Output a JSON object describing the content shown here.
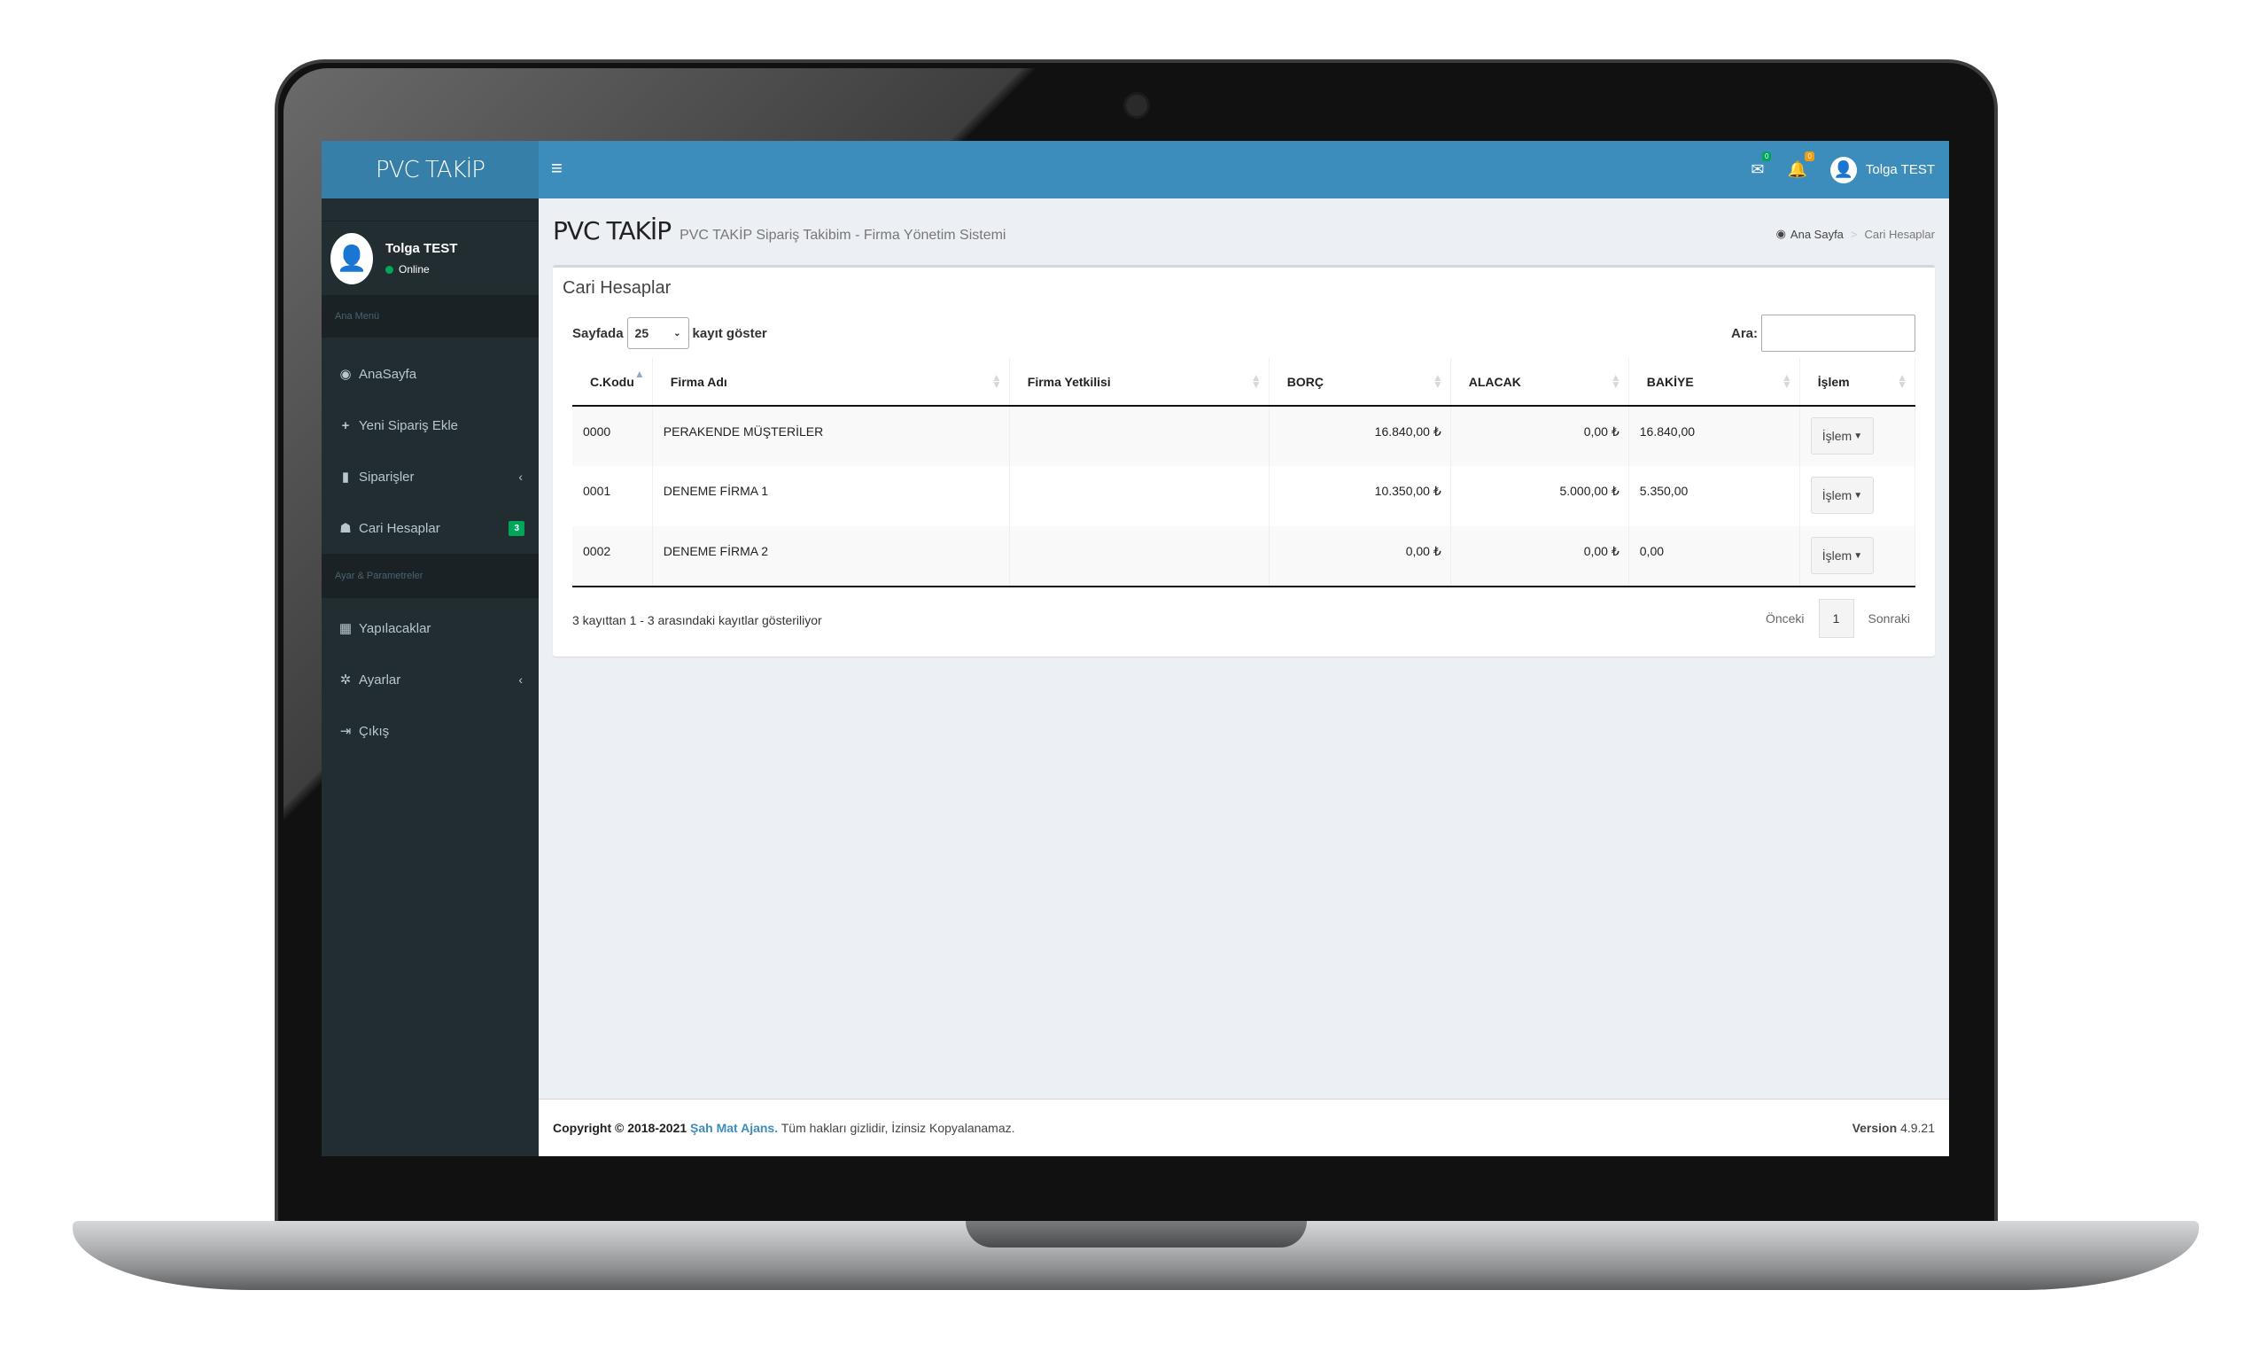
{
  "app": {
    "logo": "PVC TAKİP"
  },
  "user": {
    "name": "Tolga TEST",
    "status": "Online"
  },
  "sidebar": {
    "section_main": "Ana Menü",
    "items": [
      {
        "icon": "dashboard-icon",
        "label": "AnaSayfa"
      },
      {
        "icon": "plus-icon",
        "label": "Yeni Sipariş Ekle"
      },
      {
        "icon": "shopping-bag-icon",
        "label": "Siparişler",
        "chevron": "‹"
      },
      {
        "icon": "users-icon",
        "label": "Cari Hesaplar",
        "badge": "3"
      }
    ],
    "section_settings": "Ayar & Parametreler",
    "items2": [
      {
        "icon": "calendar-icon",
        "label": "Yapılacaklar"
      },
      {
        "icon": "gear-icon",
        "label": "Ayarlar",
        "chevron": "‹"
      },
      {
        "icon": "sign-out-icon",
        "label": "Çıkış"
      }
    ]
  },
  "topbar": {
    "hamburger": "≡",
    "mail_badge": "0",
    "bell_badge": "0",
    "user_name": "Tolga TEST"
  },
  "header": {
    "title": "PVC TAKİP",
    "subtitle": "PVC TAKİP Sipariş Takibim - Firma Yönetim Sistemi",
    "breadcrumb_home": "Ana Sayfa",
    "breadcrumb_sep": ">",
    "breadcrumb_current": "Cari Hesaplar"
  },
  "box": {
    "title": "Cari Hesaplar",
    "length_prefix": "Sayfada",
    "length_value": "25",
    "length_suffix": "kayıt göster",
    "search_label": "Ara:"
  },
  "table": {
    "columns": [
      "C.Kodu",
      "Firma Adı",
      "Firma Yetkilisi",
      "BORÇ",
      "ALACAK",
      "BAKİYE",
      "İşlem"
    ],
    "rows": [
      {
        "code": "0000",
        "name": "PERAKENDE MÜŞTERİLER",
        "contact": "",
        "debt": "16.840,00 ₺",
        "credit": "0,00 ₺",
        "balance": "16.840,00",
        "action": "İşlem"
      },
      {
        "code": "0001",
        "name": "DENEME FİRMA 1",
        "contact": "",
        "debt": "10.350,00 ₺",
        "credit": "5.000,00 ₺",
        "balance": "5.350,00",
        "action": "İşlem"
      },
      {
        "code": "0002",
        "name": "DENEME FİRMA 2",
        "contact": "",
        "debt": "0,00 ₺",
        "credit": "0,00 ₺",
        "balance": "0,00",
        "action": "İşlem"
      }
    ]
  },
  "pagination": {
    "info": "3 kayıttan 1 - 3 arasındaki kayıtlar gösteriliyor",
    "prev": "Önceki",
    "page": "1",
    "next": "Sonraki"
  },
  "footer": {
    "copyright": "Copyright © 2018-2021",
    "company": "Şah Mat Ajans.",
    "rights": "Tüm hakları gizlidir, İzinsiz Kopyalanamaz.",
    "version_label": "Version",
    "version": "4.9.21"
  },
  "colors": {
    "sidebar": "#222d32",
    "logo_bar": "#367fa9",
    "topbar": "#3c8dbc",
    "badge_green": "#00a65a",
    "badge_orange": "#f39c12"
  }
}
